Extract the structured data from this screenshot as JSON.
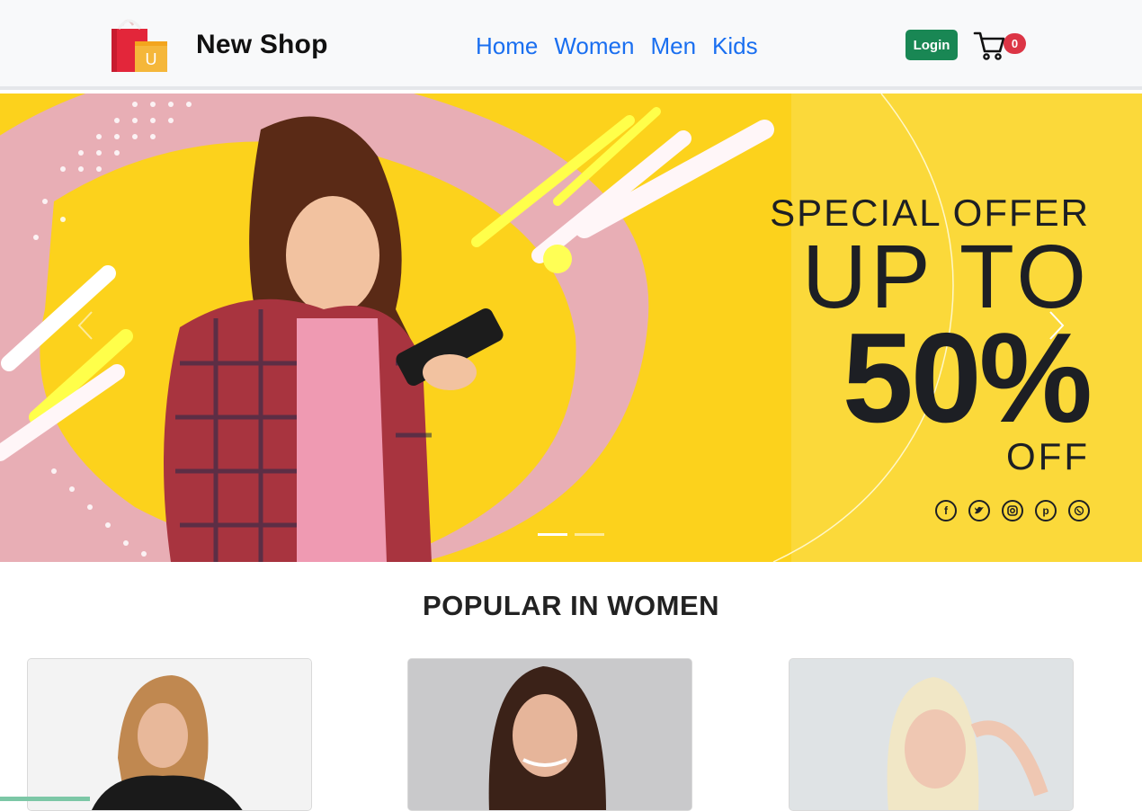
{
  "navbar": {
    "brand_name": "New Shop",
    "links": [
      "Home",
      "Women",
      "Men",
      "Kids"
    ],
    "login_label": "Login",
    "cart_count": "0",
    "link_color": "#1a6ff0",
    "login_color": "#198754",
    "badge_color": "#dc3545"
  },
  "hero": {
    "line1": "SPECIAL OFFER",
    "line2": "UP TO",
    "line3": "50%",
    "line4": "OFF",
    "prev_icon": "chevron-left-icon",
    "next_icon": "chevron-right-icon",
    "socials": [
      "facebook-icon",
      "twitter-icon",
      "instagram-icon",
      "pinterest-icon",
      "whatsapp-icon"
    ],
    "slides": 2,
    "active_slide": 1,
    "bg_color": "#fcd21c"
  },
  "section": {
    "title": "POPULAR IN WOMEN"
  }
}
